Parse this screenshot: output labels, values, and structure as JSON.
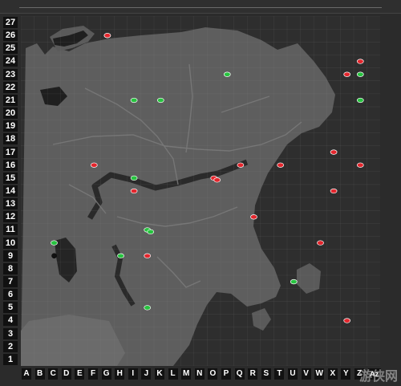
{
  "rows": [
    "27",
    "26",
    "25",
    "24",
    "23",
    "22",
    "21",
    "20",
    "19",
    "18",
    "17",
    "16",
    "15",
    "14",
    "13",
    "12",
    "11",
    "10",
    "9",
    "8",
    "7",
    "6",
    "5",
    "4",
    "3",
    "2",
    "1"
  ],
  "cols": [
    "A",
    "B",
    "C",
    "D",
    "E",
    "F",
    "G",
    "H",
    "I",
    "J",
    "K",
    "L",
    "M",
    "N",
    "O",
    "P",
    "Q",
    "R",
    "S",
    "T",
    "U",
    "V",
    "W",
    "X",
    "Y",
    "Z",
    "Az"
  ],
  "markers": {
    "green": [
      {
        "col": "G",
        "row": 26
      },
      {
        "col": "P",
        "row": 23
      },
      {
        "col": "I",
        "row": 21
      },
      {
        "col": "K",
        "row": 21
      },
      {
        "col": "Z",
        "row": 23
      },
      {
        "col": "Z",
        "row": 21
      },
      {
        "col": "I",
        "row": 15
      },
      {
        "col": "J",
        "row": 11
      },
      {
        "col": "J",
        "row": 11
      },
      {
        "col": "C",
        "row": 10
      },
      {
        "col": "H",
        "row": 9
      },
      {
        "col": "U",
        "row": 7
      },
      {
        "col": "J",
        "row": 5
      }
    ],
    "red": [
      {
        "col": "G",
        "row": 26
      },
      {
        "col": "Z",
        "row": 24
      },
      {
        "col": "Y",
        "row": 23
      },
      {
        "col": "F",
        "row": 16
      },
      {
        "col": "Q",
        "row": 16
      },
      {
        "col": "O",
        "row": 15
      },
      {
        "col": "O",
        "row": 15
      },
      {
        "col": "T",
        "row": 16
      },
      {
        "col": "X",
        "row": 17
      },
      {
        "col": "Z",
        "row": 16
      },
      {
        "col": "X",
        "row": 14
      },
      {
        "col": "I",
        "row": 14
      },
      {
        "col": "R",
        "row": 12
      },
      {
        "col": "W",
        "row": 10
      },
      {
        "col": "J",
        "row": 9
      },
      {
        "col": "Y",
        "row": 4
      }
    ],
    "black": [
      {
        "col": "C",
        "row": 9
      }
    ]
  },
  "colors": {
    "green": "#27c33f",
    "red": "#e3262d",
    "black": "#111111",
    "land": "#5e5e5e",
    "water": "#2e2e2e",
    "road": "#7a7a7a"
  },
  "watermark": "游侠网"
}
